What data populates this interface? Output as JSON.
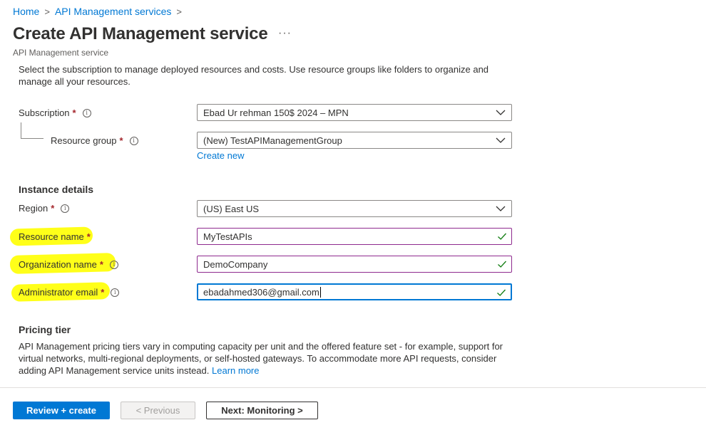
{
  "breadcrumb": {
    "home": "Home",
    "sep": ">",
    "services": "API Management services"
  },
  "page": {
    "title": "Create API Management service",
    "more": "···",
    "subtitle": "API Management service",
    "description": "Select the subscription to manage deployed resources and costs. Use resource groups like folders to organize and manage all your resources."
  },
  "form": {
    "required_mark": "*",
    "info_glyph": "i",
    "subscription": {
      "label": "Subscription",
      "value": "Ebad Ur rehman 150$ 2024 – MPN"
    },
    "resource_group": {
      "label": "Resource group",
      "value": "(New) TestAPIManagementGroup",
      "create_new": "Create new"
    },
    "instance_details": "Instance details",
    "region": {
      "label": "Region",
      "value": "(US) East US"
    },
    "resource_name": {
      "label": "Resource name",
      "value": "MyTestAPIs"
    },
    "organization_name": {
      "label": "Organization name",
      "value": "DemoCompany"
    },
    "admin_email": {
      "label": "Administrator email",
      "value": "ebadahmed306@gmail.com"
    }
  },
  "pricing": {
    "title": "Pricing tier",
    "text": "API Management pricing tiers vary in computing capacity per unit and the offered feature set - for example, support for virtual networks, multi-regional deployments, or self-hosted gateways. To accommodate more API requests, consider adding API Management service units instead.",
    "learn_more": "Learn more"
  },
  "footer": {
    "review_create": "Review + create",
    "previous": "< Previous",
    "next": "Next: Monitoring >"
  },
  "colors": {
    "accent": "#0078d4",
    "required": "#a4262c",
    "valid_check": "#107c10",
    "highlight": "#ffff00"
  },
  "icons": [
    "chevron-right-icon",
    "chevron-down-icon",
    "info-icon",
    "checkmark-icon",
    "more-icon"
  ]
}
